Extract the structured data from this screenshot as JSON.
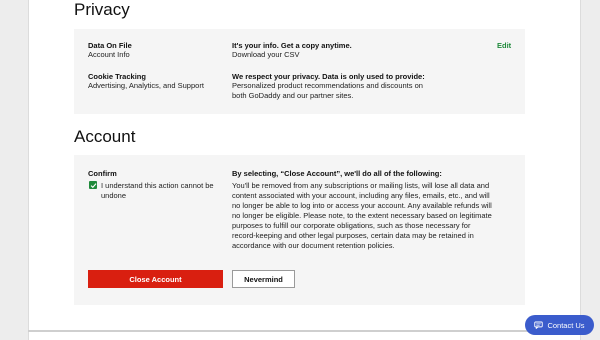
{
  "privacy": {
    "title": "Privacy",
    "data_on_file": {
      "label": "Data On File",
      "sublabel": "Account Info",
      "heading": "It's your info. Get a copy anytime.",
      "action": "Download your CSV",
      "edit": "Edit"
    },
    "cookie_tracking": {
      "label": "Cookie Tracking",
      "sublabel": "Advertising, Analytics, and Support",
      "heading": "We respect your privacy. Data is only used to provide:",
      "body_line1": "Personalized product recommendations and discounts on",
      "body_line2": "both GoDaddy and our partner sites."
    }
  },
  "account": {
    "title": "Account",
    "confirm_label": "Confirm",
    "checkbox_checked": true,
    "checkbox_line1": "I understand this action cannot be",
    "checkbox_line2": "undone",
    "warning_heading": "By selecting, “Close Account”, we'll do all of the following:",
    "warning_lines": [
      "You'll be removed from any subscriptions or mailing lists, will lose all data and",
      "content associated with your account, including any files, emails, etc., and will",
      "no longer be able to log into or access your account. Any available refunds will",
      "no longer be eligible. Please note, to the extent necessary based on legitimate",
      "purposes to fulfill our corporate obligations, such as those necessary for",
      "record-keeping and other legal purposes, certain data may be retained in",
      "accordance with our document retention policies."
    ],
    "close_button": "Close Account",
    "nevermind_button": "Nevermind"
  },
  "contact_button": "Contact Us",
  "colors": {
    "accent_green": "#1f8a3b",
    "danger_red": "#d91f10",
    "contact_blue": "#3b5ccc"
  }
}
